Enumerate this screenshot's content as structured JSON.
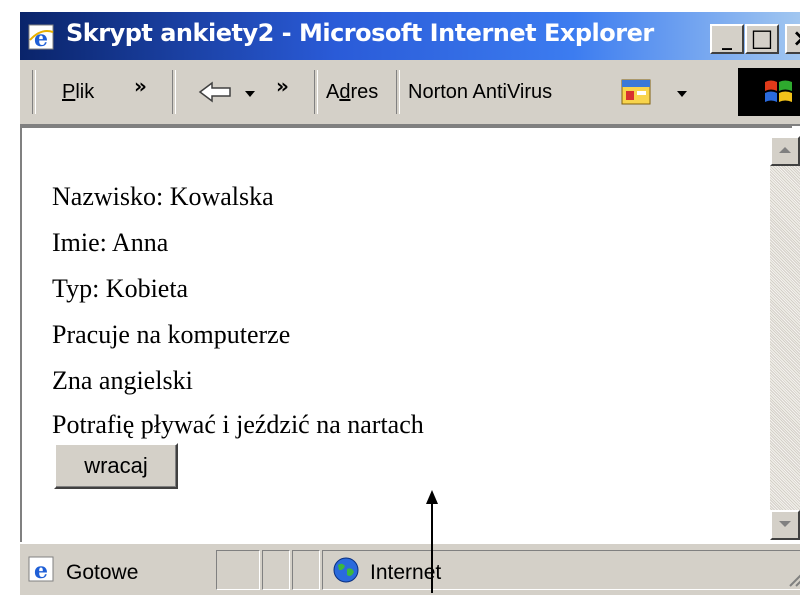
{
  "window": {
    "title": "Skrypt ankiety2 - Microsoft Internet Explorer",
    "controls": {
      "minimize": "_",
      "maximize": "□",
      "close": "×"
    }
  },
  "toolbar": {
    "menu_file": "Plik",
    "chevron": "»",
    "address_label": "Adres",
    "norton_label": "Norton AntiVirus",
    "back_glyph": "⇦",
    "dropdown_glyph": "▾"
  },
  "content": {
    "lines": [
      "Nazwisko: Kowalska",
      "Imie: Anna",
      "Typ: Kobieta",
      "Pracuje na komputerze",
      "Zna angielski",
      "Potrafię pływać i jeździć na nartach"
    ],
    "back_button": "wracaj"
  },
  "status": {
    "text": "Gotowe",
    "zone": "Internet"
  },
  "colors": {
    "titlebar_start": "#0a246a",
    "titlebar_end": "#a6caf0",
    "chrome": "#d4d0c8"
  },
  "icons": [
    "ie-icon",
    "back-arrow-icon",
    "norton-icon",
    "windows-logo-icon",
    "globe-icon",
    "page-icon"
  ]
}
